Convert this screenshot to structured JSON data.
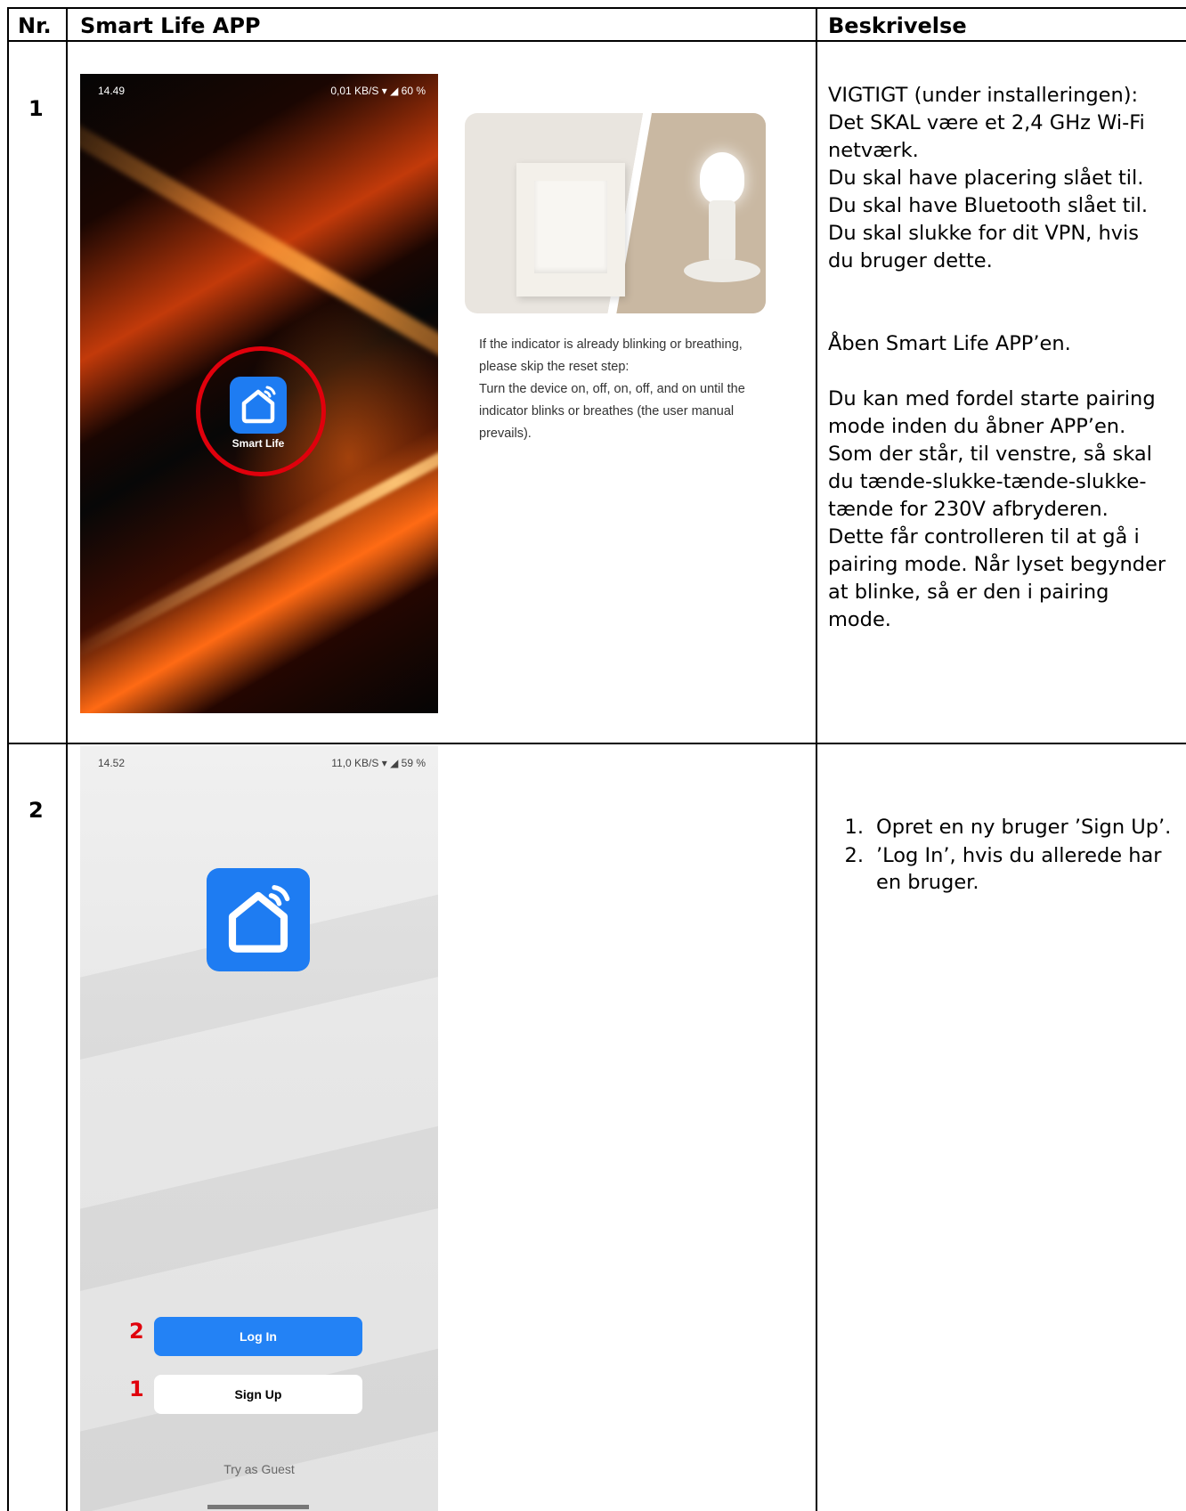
{
  "table": {
    "headers": {
      "nr": "Nr.",
      "app": "Smart Life APP",
      "desc": "Beskrivelse"
    },
    "rows": [
      {
        "nr": "1",
        "phone": {
          "time": "14.49",
          "status_right": "0,01 KB/S ▾ ◢ 60 %",
          "app_label": "Smart Life"
        },
        "hint_lines": [
          "If the indicator is already blinking or breathing,",
          "please skip the reset step:",
          "Turn the device on, off, on, off, and on until the",
          "indicator blinks or breathes (the user manual",
          "prevails)."
        ],
        "desc_lines": [
          "VIGTIGT (under installeringen):",
          "Det SKAL være et 2,4 GHz Wi-Fi",
          "netværk.",
          "Du skal have placering slået til.",
          "Du skal have Bluetooth slået til.",
          "Du skal slukke for dit VPN, hvis",
          "du bruger dette.",
          "",
          "",
          "Åben Smart Life APP’en.",
          "",
          "Du kan med fordel starte pairing",
          "mode inden du åbner APP’en.",
          "Som der står, til venstre, så skal",
          "du tænde-slukke-tænde-slukke-",
          "tænde for 230V afbryderen.",
          "Dette får controlleren til at gå i",
          "pairing mode. Når lyset begynder",
          "at blinke, så er den i pairing",
          "mode."
        ]
      },
      {
        "nr": "2",
        "phone": {
          "time": "14.52",
          "status_right": "11,0 KB/S ▾ ◢ 59 %",
          "login_label": "Log In",
          "signup_label": "Sign Up",
          "guest_label": "Try as Guest",
          "marker_login": "2",
          "marker_signup": "1"
        },
        "list": [
          {
            "n": "1.",
            "text": "Opret en ny bruger ’Sign Up’."
          },
          {
            "n": "2.",
            "text": "’Log In’, hvis du allerede har en bruger."
          }
        ]
      }
    ]
  },
  "colors": {
    "accent_blue": "#1e7cf2",
    "marker_red": "#e0000c"
  }
}
